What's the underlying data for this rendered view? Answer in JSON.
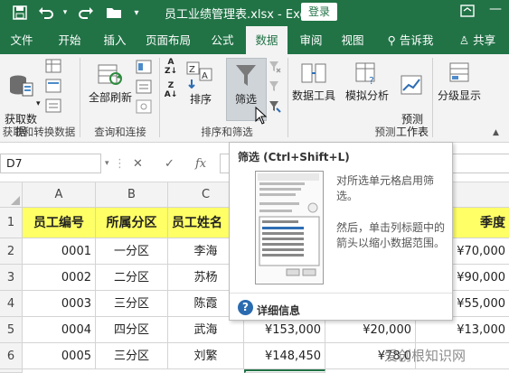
{
  "title_bar": {
    "file_title": "员工业绩管理表.xlsx  -  Excel",
    "login_label": "登录",
    "quick_access_icons": [
      "save-icon",
      "undo-icon",
      "redo-icon",
      "folder-icon",
      "customize-icon"
    ],
    "window_icons": [
      "ribbon-display-icon",
      "minimize-icon"
    ]
  },
  "tabs": [
    {
      "label": "文件"
    },
    {
      "label": "开始"
    },
    {
      "label": "插入"
    },
    {
      "label": "页面布局"
    },
    {
      "label": "公式"
    },
    {
      "label": "数据",
      "active": true
    },
    {
      "label": "审阅"
    },
    {
      "label": "视图"
    },
    {
      "label": "告诉我"
    },
    {
      "label": "共享"
    }
  ],
  "ribbon": {
    "get_data": "获取数\n据",
    "refresh_all": "全部刷新",
    "sort": "排序",
    "filter": "筛选",
    "data_tools": "数据工具",
    "what_if": "模拟分析",
    "forecast_sheet": "预测\n工作表",
    "outline": "分级显示",
    "groups": [
      "获取和转换数据",
      "查询和连接",
      "排序和筛选",
      "预测"
    ]
  },
  "formula_bar": {
    "name_box": "D7",
    "fx": "fx"
  },
  "columns": [
    "A",
    "B",
    "C"
  ],
  "rows": [
    "1",
    "2",
    "3",
    "4",
    "5",
    "6"
  ],
  "table": {
    "headers": [
      "员工编号",
      "所属分区",
      "员工姓名",
      "季度"
    ],
    "rows": [
      {
        "id": "0001",
        "area": "一分区",
        "name": "李海",
        "e": "",
        "f": "",
        "g": "¥70,000"
      },
      {
        "id": "0002",
        "area": "二分区",
        "name": "苏杨",
        "e": "",
        "f": "",
        "g": "¥90,000"
      },
      {
        "id": "0003",
        "area": "三分区",
        "name": "陈霞",
        "e": "",
        "f": "",
        "g": "¥55,000"
      },
      {
        "id": "0004",
        "area": "四分区",
        "name": "武海",
        "e": "¥153,000",
        "f": "¥20,000",
        "g": "¥13,000"
      },
      {
        "id": "0005",
        "area": "三分区",
        "name": "刘繁",
        "e": "¥148,450",
        "f": "¥78,0",
        "g": ""
      }
    ]
  },
  "tooltip": {
    "title": "筛选 (Ctrl+Shift+L)",
    "desc1": "对所选单元格启用筛选。",
    "desc2": "然后，单击列标题中的箭头以缩小数据范围。",
    "more": "详细信息"
  },
  "watermark": "爱创根知识网"
}
